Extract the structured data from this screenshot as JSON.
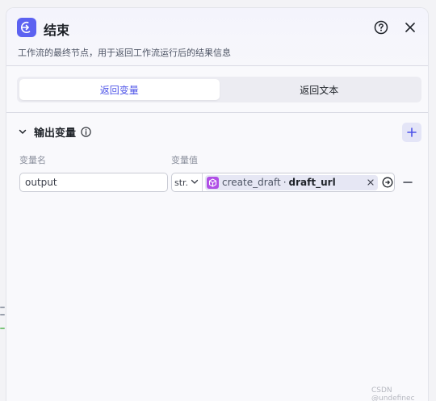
{
  "header": {
    "title": "结束",
    "subtitle": "工作流的最终节点，用于返回工作流运行后的结果信息",
    "node_icon": "exit-arrow-icon",
    "help_icon": "question-circle-icon",
    "close_icon": "close-icon"
  },
  "tabs": [
    {
      "label": "返回变量",
      "active": true
    },
    {
      "label": "返回文本",
      "active": false
    }
  ],
  "output_section": {
    "title": "输出变量",
    "column_name_label": "变量名",
    "column_value_label": "变量值",
    "rows": [
      {
        "name": "output",
        "type": "str.",
        "ref_node": "create_draft",
        "ref_separator": "·",
        "ref_variable": "draft_url"
      }
    ]
  },
  "watermark": "CSDN @undefinec",
  "colors": {
    "accent": "#4d53e8",
    "node_icon_bg": "#5c62f1",
    "ref_icon_bg": "#b04fe6"
  }
}
